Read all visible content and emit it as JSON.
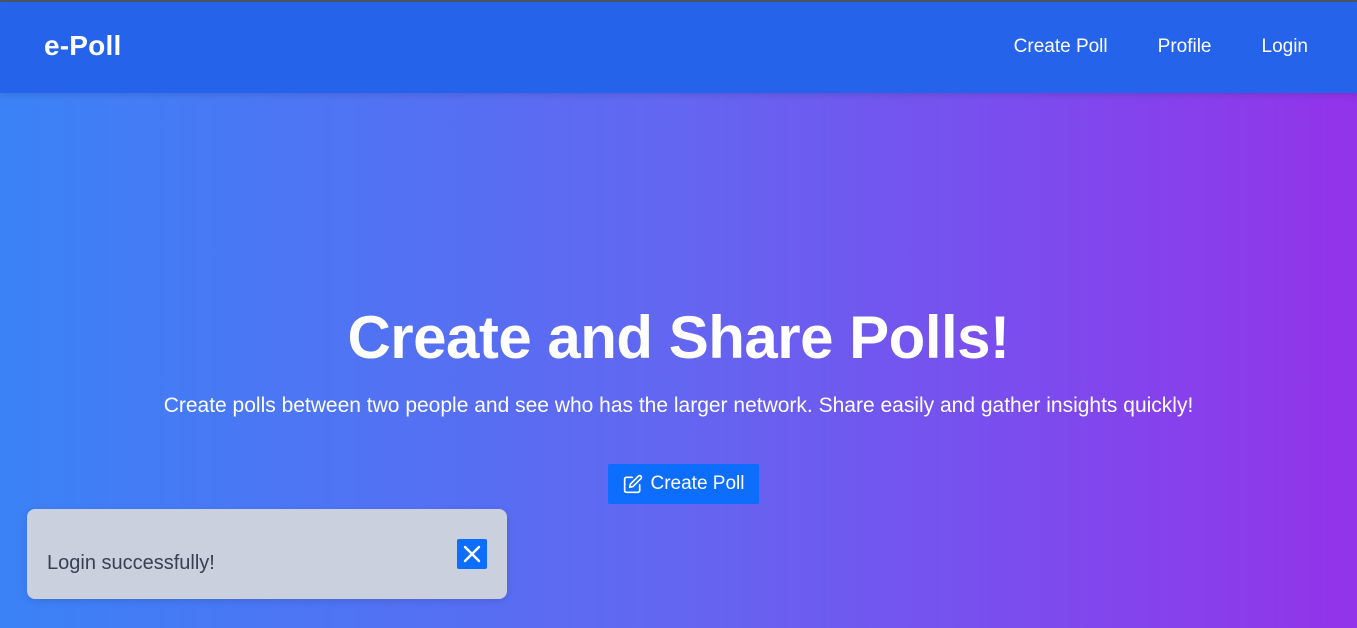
{
  "navbar": {
    "brand": "e-Poll",
    "links": [
      {
        "label": "Create Poll"
      },
      {
        "label": "Profile"
      },
      {
        "label": "Login"
      }
    ]
  },
  "hero": {
    "title": "Create and Share Polls!",
    "subtitle": "Create polls between two people and see who has the larger network. Share easily and gather insights quickly!",
    "cta": {
      "label": "Create Poll",
      "icon": "edit-icon"
    }
  },
  "toast": {
    "message": "Login successfully!",
    "close_icon": "close-icon"
  },
  "colors": {
    "navbar_bg": "#2563eb",
    "gradient_start": "#3b82f6",
    "gradient_end": "#9333ea",
    "button_bg": "#0d6efd",
    "toast_bg": "#cbd0df"
  }
}
